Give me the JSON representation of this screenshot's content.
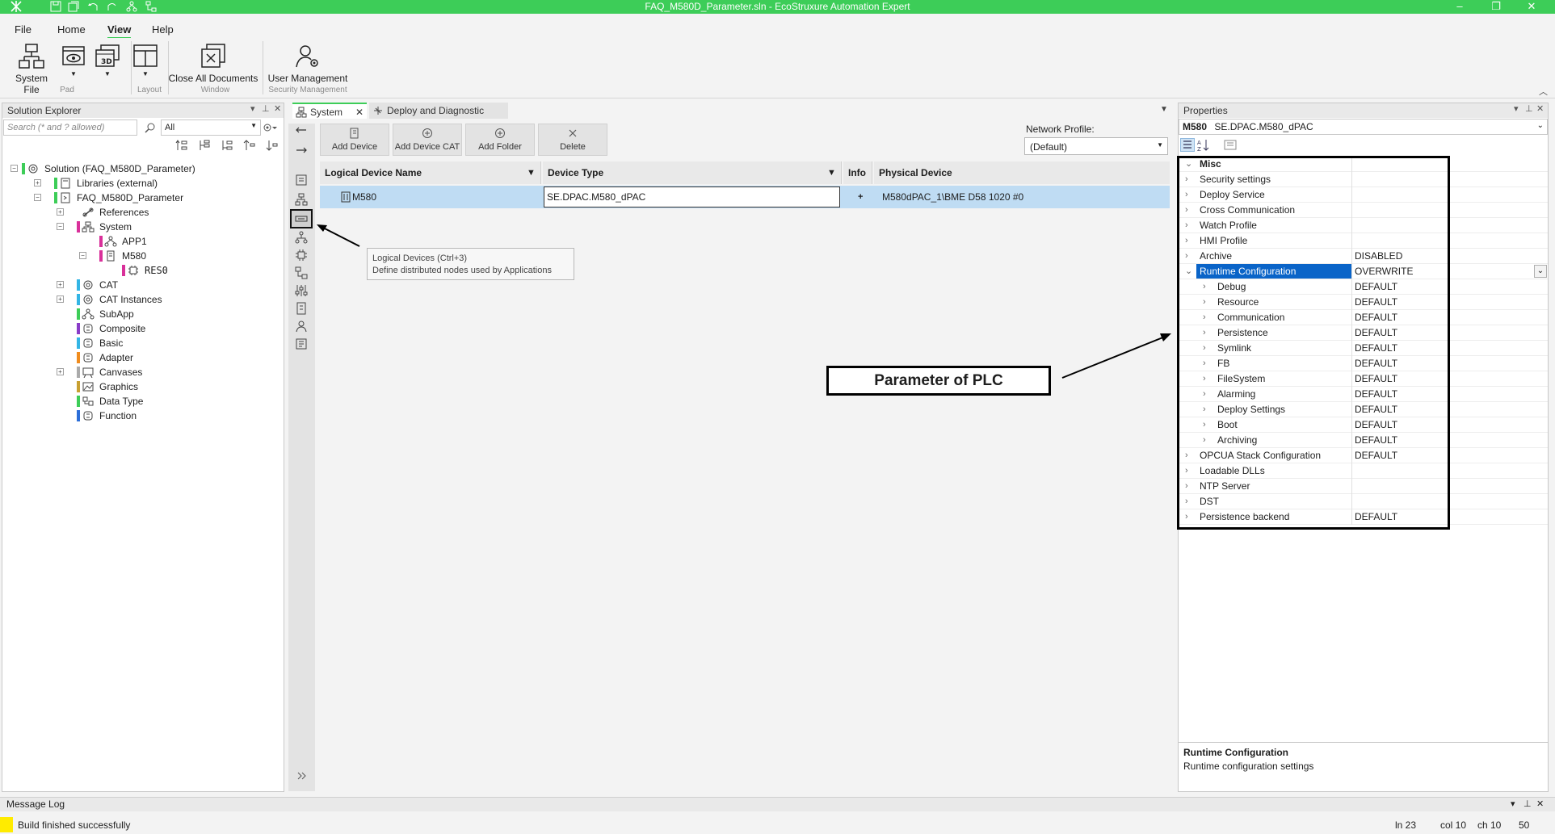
{
  "window": {
    "title": "FAQ_M580D_Parameter.sln - EcoStruxure Automation Expert",
    "minimize": "–",
    "maximize": "❐",
    "close": "✕"
  },
  "menu": [
    "File",
    "Home",
    "View",
    "Help"
  ],
  "ribbon": {
    "buttons": [
      "System File",
      "",
      "",
      "",
      "Close All Documents",
      "User Management"
    ],
    "groups": [
      "Pad",
      "Layout",
      "Window",
      "Security Management"
    ]
  },
  "solution_explorer": {
    "title": "Solution Explorer",
    "search_placeholder": "Search (* and ? allowed)",
    "filter": "All",
    "tree": [
      "Solution  (FAQ_M580D_Parameter)",
      "Libraries (external)",
      "FAQ_M580D_Parameter",
      "References",
      "System",
      "APP1",
      "M580",
      "RES0",
      "CAT",
      "CAT Instances",
      "SubApp",
      "Composite",
      "Basic",
      "Adapter",
      "Canvases",
      "Graphics",
      "Data Type",
      "Function"
    ]
  },
  "tabs": [
    "System",
    "Deploy and Diagnostic"
  ],
  "toolbar": [
    "Add Device",
    "Add Device CAT",
    "Add Folder",
    "Delete"
  ],
  "network_profile": {
    "label": "Network Profile:",
    "value": "(Default)"
  },
  "grid": {
    "headers": [
      "Logical Device Name",
      "Device Type",
      "Info",
      "Physical Device"
    ],
    "row": {
      "name": "M580",
      "type": "SE.DPAC.M580_dPAC",
      "info": "+",
      "physical": "M580dPAC_1\\BME D58 1020 #0"
    }
  },
  "tooltip": {
    "title": "Logical Devices (Ctrl+3)",
    "desc": "Define distributed nodes used by Applications"
  },
  "callout": "Parameter of PLC",
  "properties": {
    "title": "Properties",
    "object_name": "M580",
    "object_type": "SE.DPAC.M580_dPAC",
    "rows": [
      {
        "name": "Misc",
        "value": ""
      },
      {
        "name": "Security settings",
        "value": ""
      },
      {
        "name": "Deploy Service",
        "value": ""
      },
      {
        "name": "Cross Communication",
        "value": ""
      },
      {
        "name": "Watch Profile",
        "value": ""
      },
      {
        "name": "HMI Profile",
        "value": ""
      },
      {
        "name": "Archive",
        "value": "DISABLED"
      },
      {
        "name": "Runtime Configuration",
        "value": "OVERWRITE"
      },
      {
        "name": "Debug",
        "value": "DEFAULT"
      },
      {
        "name": "Resource",
        "value": "DEFAULT"
      },
      {
        "name": "Communication",
        "value": "DEFAULT"
      },
      {
        "name": "Persistence",
        "value": "DEFAULT"
      },
      {
        "name": "Symlink",
        "value": "DEFAULT"
      },
      {
        "name": "FB",
        "value": "DEFAULT"
      },
      {
        "name": "FileSystem",
        "value": "DEFAULT"
      },
      {
        "name": "Alarming",
        "value": "DEFAULT"
      },
      {
        "name": "Deploy Settings",
        "value": "DEFAULT"
      },
      {
        "name": "Boot",
        "value": "DEFAULT"
      },
      {
        "name": "Archiving",
        "value": "DEFAULT"
      },
      {
        "name": "OPCUA Stack Configuration",
        "value": "DEFAULT"
      },
      {
        "name": "Loadable DLLs",
        "value": ""
      },
      {
        "name": "NTP Server",
        "value": ""
      },
      {
        "name": "DST",
        "value": ""
      },
      {
        "name": "Persistence backend",
        "value": "DEFAULT"
      }
    ],
    "desc_title": "Runtime Configuration",
    "desc_text": "Runtime configuration settings"
  },
  "message_log": {
    "title": "Message Log"
  },
  "status": {
    "message": "Build finished successfully",
    "ln": "ln 23",
    "col": "col 10",
    "ch": "ch 10",
    "zoom": "50"
  },
  "colors": {
    "accent": "#3dcd58",
    "selection": "#bfdcf3",
    "highlight": "#0a64c8"
  }
}
